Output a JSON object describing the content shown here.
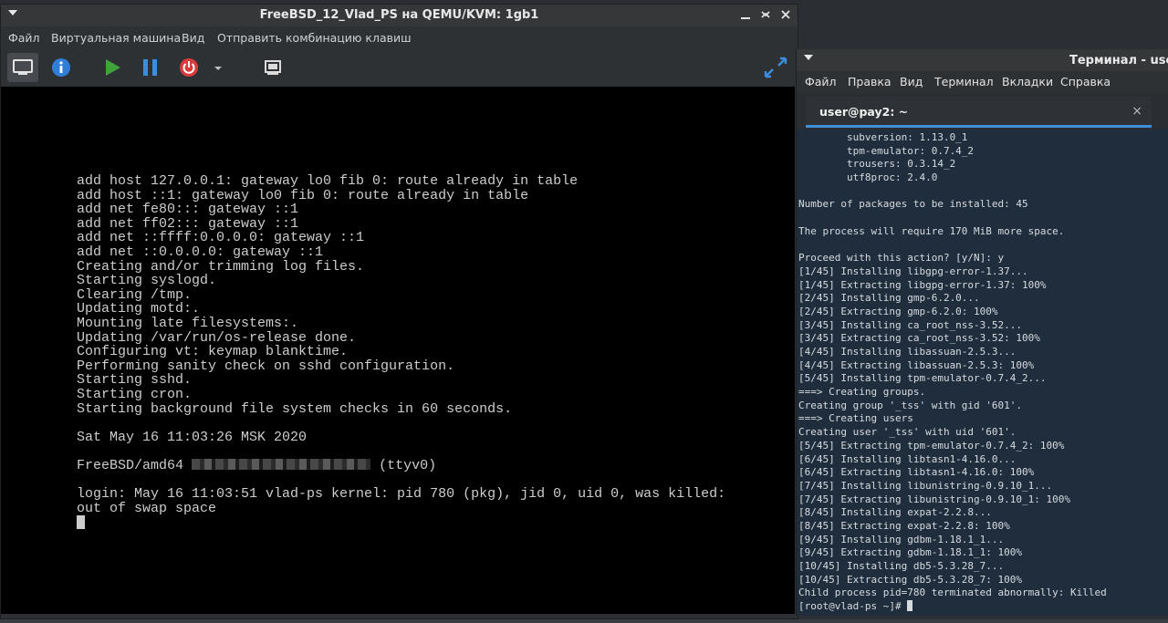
{
  "vm": {
    "title": "FreeBSD_12_Vlad_PS на QEMU/KVM: 1gb1",
    "menu": [
      "Файл",
      "Виртуальная машина",
      "Вид",
      "Отправить комбинацию клавиш"
    ],
    "toolbar_icons": [
      "console-icon",
      "details-info-icon",
      "run-icon",
      "pause-icon",
      "shutdown-icon",
      "shutdown-menu-chevron-icon",
      "snapshot-icon",
      "fullscreen-icon"
    ],
    "console": {
      "lines": [
        "add host 127.0.0.1: gateway lo0 fib 0: route already in table",
        "add host ::1: gateway lo0 fib 0: route already in table",
        "add net fe80::: gateway ::1",
        "add net ff02::: gateway ::1",
        "add net ::ffff:0.0.0.0: gateway ::1",
        "add net ::0.0.0.0: gateway ::1",
        "Creating and/or trimming log files.",
        "Starting syslogd.",
        "Clearing /tmp.",
        "Updating motd:.",
        "Mounting late filesystems:.",
        "Updating /var/run/os-release done.",
        "Configuring vt: keymap blanktime.",
        "Performing sanity check on sshd configuration.",
        "Starting sshd.",
        "Starting cron.",
        "Starting background file system checks in 60 seconds."
      ],
      "date_line": "Sat May 16 11:03:26 MSK 2020",
      "host_prefix": "FreeBSD/amd64",
      "host_suffix": "(ttyv0)",
      "login_line1": "login: May 16 11:03:51 vlad-ps kernel: pid 780 (pkg), jid 0, uid 0, was killed:",
      "login_line2": "out of swap space"
    }
  },
  "terminal": {
    "title": "Терминал - user@p",
    "menu": [
      "Файл",
      "Правка",
      "Вид",
      "Терминал",
      "Вкладки",
      "Справка"
    ],
    "tab_label": "user@pay2: ~",
    "tab_close": "×",
    "lines": [
      "        subversion: 1.13.0_1",
      "        tpm-emulator: 0.7.4_2",
      "        trousers: 0.3.14_2",
      "        utf8proc: 2.4.0",
      "",
      "Number of packages to be installed: 45",
      "",
      "The process will require 170 MiB more space.",
      "",
      "Proceed with this action? [y/N]: y",
      "[1/45] Installing libgpg-error-1.37...",
      "[1/45] Extracting libgpg-error-1.37: 100%",
      "[2/45] Installing gmp-6.2.0...",
      "[2/45] Extracting gmp-6.2.0: 100%",
      "[3/45] Installing ca_root_nss-3.52...",
      "[3/45] Extracting ca_root_nss-3.52: 100%",
      "[4/45] Installing libassuan-2.5.3...",
      "[4/45] Extracting libassuan-2.5.3: 100%",
      "[5/45] Installing tpm-emulator-0.7.4_2...",
      "===> Creating groups.",
      "Creating group '_tss' with gid '601'.",
      "===> Creating users",
      "Creating user '_tss' with uid '601'.",
      "[5/45] Extracting tpm-emulator-0.7.4_2: 100%",
      "[6/45] Installing libtasn1-4.16.0...",
      "[6/45] Extracting libtasn1-4.16.0: 100%",
      "[7/45] Installing libunistring-0.9.10_1...",
      "[7/45] Extracting libunistring-0.9.10_1: 100%",
      "[8/45] Installing expat-2.2.8...",
      "[8/45] Extracting expat-2.2.8: 100%",
      "[9/45] Installing gdbm-1.18.1_1...",
      "[9/45] Extracting gdbm-1.18.1_1: 100%",
      "[10/45] Installing db5-5.3.28_7...",
      "[10/45] Extracting db5-5.3.28_7: 100%",
      "Child process pid=780 terminated abnormally: Killed"
    ],
    "prompt": "[root@vlad-ps ~]# "
  }
}
